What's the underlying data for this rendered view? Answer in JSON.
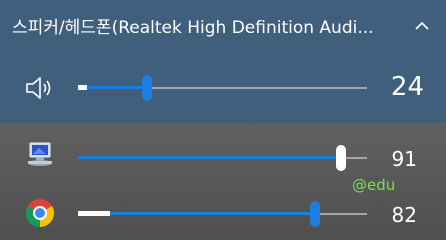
{
  "device": {
    "name": "스피커/헤드폰(Realtek High Definition Audi...",
    "volume": 24,
    "volume_label": "24",
    "peak_level": 0.03,
    "icon": "speaker-icon",
    "expand_icon": "chevron-up-icon"
  },
  "apps": [
    {
      "icon": "system-sounds-icon",
      "volume": 91,
      "volume_label": "91",
      "peak_level": 0.0
    },
    {
      "icon": "chrome-icon",
      "volume": 82,
      "volume_label": "82",
      "peak_level": 0.11
    }
  ],
  "watermark": "@edu",
  "colors": {
    "device_panel": "#3f5f7d",
    "app_panel": "#5f5f5f",
    "accent": "#1e7ee0",
    "track": "#9fa7b0",
    "watermark": "#7be04b"
  }
}
